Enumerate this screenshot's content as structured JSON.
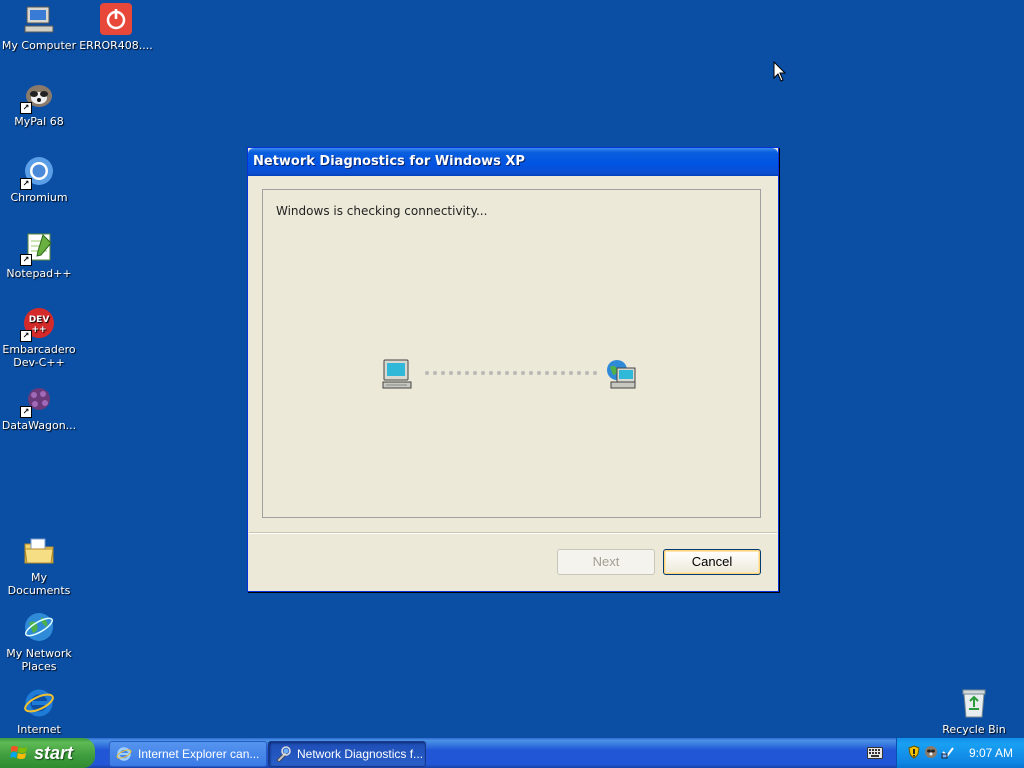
{
  "desktop": {
    "icons": [
      {
        "label": "My Computer"
      },
      {
        "label": "ERROR408...."
      },
      {
        "label": "MyPal 68"
      },
      {
        "label": "Chromium"
      },
      {
        "label": "Notepad++"
      },
      {
        "label": "Embarcadero Dev-C++"
      },
      {
        "label": "DataWagon..."
      },
      {
        "label": "My Documents"
      },
      {
        "label": "My Network Places"
      },
      {
        "label": "Internet"
      },
      {
        "label": "Recycle Bin"
      }
    ]
  },
  "dialog": {
    "title": "Network Diagnostics for Windows XP",
    "status": "Windows is checking connectivity...",
    "next_label": "Next",
    "cancel_label": "Cancel"
  },
  "taskbar": {
    "start_label": "start",
    "tasks": [
      {
        "label": "Internet Explorer can...",
        "icon": "ie-icon"
      },
      {
        "label": "Network Diagnostics f...",
        "icon": "network-diagnostics-icon"
      }
    ],
    "clock": "9:07 AM"
  },
  "colors": {
    "desktop": "#0b4fa5",
    "title_bar": "#0054e3",
    "dialog_bg": "#ece9d8",
    "start_green": "#3e9c3e"
  }
}
